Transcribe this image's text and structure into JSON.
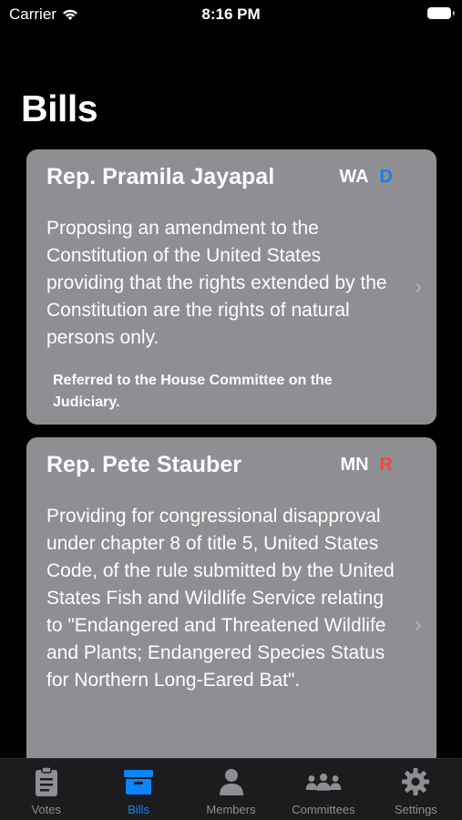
{
  "status_bar": {
    "carrier": "Carrier",
    "time": "8:16 PM"
  },
  "header": {
    "title": "Bills"
  },
  "bills": [
    {
      "sponsor": "Rep. Pramila Jayapal",
      "state": "WA",
      "party": "D",
      "title": "Proposing an amendment to the Constitution of the United States providing that the rights extended by the Constitution are the rights of natural persons only.",
      "status": "Referred to the House Committee on the Judiciary."
    },
    {
      "sponsor": "Rep. Pete Stauber",
      "state": "MN",
      "party": "R",
      "title": "Providing for congressional disapproval under chapter 8 of title 5, United States Code, of the rule submitted by the United States Fish and Wildlife Service relating to \"Endangered and Threatened Wildlife and Plants; Endangered Species Status for Northern Long-Eared Bat\".",
      "status": ""
    }
  ],
  "colors": {
    "democrat": "#0a84ff",
    "republican": "#ff453a",
    "card": "#8e8e93",
    "tab_active": "#0a84ff"
  },
  "tabs": [
    {
      "label": "Votes",
      "icon": "clipboard-icon",
      "active": false
    },
    {
      "label": "Bills",
      "icon": "archive-box-icon",
      "active": true
    },
    {
      "label": "Members",
      "icon": "person-icon",
      "active": false
    },
    {
      "label": "Committees",
      "icon": "group-icon",
      "active": false
    },
    {
      "label": "Settings",
      "icon": "gear-icon",
      "active": false
    }
  ]
}
